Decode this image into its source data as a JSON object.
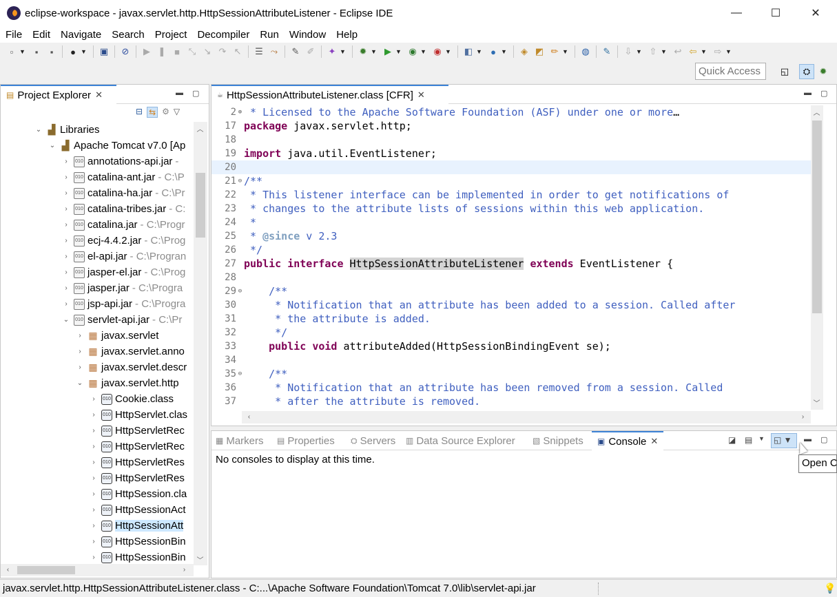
{
  "window": {
    "title": "eclipse-workspace - javax.servlet.http.HttpSessionAttributeListener - Eclipse IDE",
    "min_glyph": "—",
    "max_glyph": "☐",
    "close_glyph": "✕"
  },
  "menu": [
    "File",
    "Edit",
    "Navigate",
    "Search",
    "Project",
    "Decompiler",
    "Run",
    "Window",
    "Help"
  ],
  "quick_access": {
    "placeholder": "Quick Access"
  },
  "explorer": {
    "tab_label": "Project Explorer",
    "tab_close": "✕",
    "tree": [
      {
        "label": "Libraries",
        "path": "",
        "icon": "library-icon",
        "level": 0,
        "expanded": true
      },
      {
        "label": "Apache Tomcat v7.0 [Ap",
        "path": "",
        "icon": "library-icon",
        "level": 1,
        "expanded": true
      },
      {
        "label": "annotations-api.jar",
        "path": " - ",
        "icon": "jar-icon",
        "level": 2,
        "expanded": false
      },
      {
        "label": "catalina-ant.jar",
        "path": " - C:\\P",
        "icon": "jar-icon",
        "level": 2,
        "expanded": false
      },
      {
        "label": "catalina-ha.jar",
        "path": " - C:\\Pr",
        "icon": "jar-icon",
        "level": 2,
        "expanded": false
      },
      {
        "label": "catalina-tribes.jar",
        "path": " - C:",
        "icon": "jar-icon",
        "level": 2,
        "expanded": false
      },
      {
        "label": "catalina.jar",
        "path": " - C:\\Progr",
        "icon": "jar-icon",
        "level": 2,
        "expanded": false
      },
      {
        "label": "ecj-4.4.2.jar",
        "path": " - C:\\Prog",
        "icon": "jar-icon",
        "level": 2,
        "expanded": false
      },
      {
        "label": "el-api.jar",
        "path": " - C:\\Progran",
        "icon": "jar-icon",
        "level": 2,
        "expanded": false
      },
      {
        "label": "jasper-el.jar",
        "path": " - C:\\Prog",
        "icon": "jar-icon",
        "level": 2,
        "expanded": false
      },
      {
        "label": "jasper.jar",
        "path": " - C:\\Progra",
        "icon": "jar-icon",
        "level": 2,
        "expanded": false
      },
      {
        "label": "jsp-api.jar",
        "path": " - C:\\Progra",
        "icon": "jar-icon",
        "level": 2,
        "expanded": false
      },
      {
        "label": "servlet-api.jar",
        "path": " - C:\\Pr",
        "icon": "jar-icon",
        "level": 2,
        "expanded": true
      },
      {
        "label": "javax.servlet",
        "path": "",
        "icon": "package-icon",
        "level": 3,
        "expanded": false
      },
      {
        "label": "javax.servlet.anno",
        "path": "",
        "icon": "package-icon",
        "level": 3,
        "expanded": false
      },
      {
        "label": "javax.servlet.descr",
        "path": "",
        "icon": "package-icon",
        "level": 3,
        "expanded": false
      },
      {
        "label": "javax.servlet.http",
        "path": "",
        "icon": "package-icon",
        "level": 3,
        "expanded": true
      },
      {
        "label": "Cookie.class",
        "path": "",
        "icon": "class-file-icon",
        "level": 4,
        "expanded": false
      },
      {
        "label": "HttpServlet.clas",
        "path": "",
        "icon": "class-file-icon",
        "level": 4,
        "expanded": false
      },
      {
        "label": "HttpServletRec",
        "path": "",
        "icon": "class-file-icon",
        "level": 4,
        "expanded": false
      },
      {
        "label": "HttpServletRec",
        "path": "",
        "icon": "class-file-icon",
        "level": 4,
        "expanded": false
      },
      {
        "label": "HttpServletRes",
        "path": "",
        "icon": "class-file-icon",
        "level": 4,
        "expanded": false
      },
      {
        "label": "HttpServletRes",
        "path": "",
        "icon": "class-file-icon",
        "level": 4,
        "expanded": false
      },
      {
        "label": "HttpSession.cla",
        "path": "",
        "icon": "class-file-icon",
        "level": 4,
        "expanded": false
      },
      {
        "label": "HttpSessionAct",
        "path": "",
        "icon": "class-file-icon",
        "level": 4,
        "expanded": false
      },
      {
        "label": "HttpSessionAtt",
        "path": "",
        "icon": "class-file-icon",
        "level": 4,
        "expanded": false,
        "selected": true
      },
      {
        "label": "HttpSessionBin",
        "path": "",
        "icon": "class-file-icon",
        "level": 4,
        "expanded": false
      },
      {
        "label": "HttpSessionBin",
        "path": "",
        "icon": "class-file-icon",
        "level": 4,
        "expanded": false
      }
    ]
  },
  "editor": {
    "tab_label": "HttpSessionAttributeListener.class [CFR]",
    "tab_close": "✕",
    "lines": [
      {
        "n": "2",
        "fold": "⊕",
        "parts": [
          [
            " * Licensed to the Apache Software Foundation (ASF) under one or more",
            "cm"
          ],
          [
            "…",
            "pl"
          ]
        ]
      },
      {
        "n": "17",
        "fold": "",
        "parts": [
          [
            "package",
            "kw"
          ],
          [
            " javax.servlet.http;",
            "pl"
          ]
        ]
      },
      {
        "n": "18",
        "fold": "",
        "parts": []
      },
      {
        "n": "19",
        "fold": "",
        "parts": [
          [
            "import",
            "kw"
          ],
          [
            " java.util.EventListener;",
            "pl"
          ]
        ]
      },
      {
        "n": "20",
        "fold": "",
        "parts": [],
        "current": true
      },
      {
        "n": "21",
        "fold": "⊖",
        "parts": [
          [
            "/**",
            "cm"
          ]
        ]
      },
      {
        "n": "22",
        "fold": "",
        "parts": [
          [
            " * This listener interface can be implemented in order to get notifications of",
            "cm"
          ]
        ]
      },
      {
        "n": "23",
        "fold": "",
        "parts": [
          [
            " * changes to the attribute lists of sessions within this web application.",
            "cm"
          ]
        ]
      },
      {
        "n": "24",
        "fold": "",
        "parts": [
          [
            " *",
            "cm"
          ]
        ]
      },
      {
        "n": "25",
        "fold": "",
        "parts": [
          [
            " * ",
            "cm"
          ],
          [
            "@since",
            "tg"
          ],
          [
            " v 2.3",
            "cm"
          ]
        ]
      },
      {
        "n": "26",
        "fold": "",
        "parts": [
          [
            " */",
            "cm"
          ]
        ]
      },
      {
        "n": "27",
        "fold": "",
        "parts": [
          [
            "public",
            "kw"
          ],
          [
            " ",
            "pl"
          ],
          [
            "interface",
            "kw"
          ],
          [
            " ",
            "pl"
          ],
          [
            "HttpSessionAttributeListener",
            "hl"
          ],
          [
            " ",
            "pl"
          ],
          [
            "extends",
            "kw"
          ],
          [
            " EventListener {",
            "pl"
          ]
        ]
      },
      {
        "n": "28",
        "fold": "",
        "parts": []
      },
      {
        "n": "29",
        "fold": "⊖",
        "parts": [
          [
            "    /**",
            "cm"
          ]
        ]
      },
      {
        "n": "30",
        "fold": "",
        "parts": [
          [
            "     * Notification that an attribute has been added to a session. Called after",
            "cm"
          ]
        ]
      },
      {
        "n": "31",
        "fold": "",
        "parts": [
          [
            "     * the attribute is added.",
            "cm"
          ]
        ]
      },
      {
        "n": "32",
        "fold": "",
        "parts": [
          [
            "     */",
            "cm"
          ]
        ]
      },
      {
        "n": "33",
        "fold": "",
        "parts": [
          [
            "    ",
            "pl"
          ],
          [
            "public",
            "kw"
          ],
          [
            " ",
            "pl"
          ],
          [
            "void",
            "kw"
          ],
          [
            " attributeAdded(HttpSessionBindingEvent se);",
            "pl"
          ]
        ]
      },
      {
        "n": "34",
        "fold": "",
        "parts": []
      },
      {
        "n": "35",
        "fold": "⊖",
        "parts": [
          [
            "    /**",
            "cm"
          ]
        ]
      },
      {
        "n": "36",
        "fold": "",
        "parts": [
          [
            "     * Notification that an attribute has been removed from a session. Called",
            "cm"
          ]
        ]
      },
      {
        "n": "37",
        "fold": "",
        "parts": [
          [
            "     * after the attribute is removed.",
            "cm"
          ]
        ]
      }
    ]
  },
  "console": {
    "tabs": [
      {
        "label": "Markers",
        "icon": "markers-icon",
        "glyph": "▦"
      },
      {
        "label": "Properties",
        "icon": "properties-icon",
        "glyph": "▤"
      },
      {
        "label": "Servers",
        "icon": "servers-icon",
        "glyph": "⛭"
      },
      {
        "label": "Data Source Explorer",
        "icon": "data-source-icon",
        "glyph": "▥"
      },
      {
        "label": "Snippets",
        "icon": "snippets-icon",
        "glyph": "▧"
      }
    ],
    "active_tab": "Console",
    "active_close": "✕",
    "message": "No consoles to display at this time.",
    "tooltip": "Open C"
  },
  "status": {
    "text": "javax.servlet.http.HttpSessionAttributeListener.class - C:...\\Apache Software Foundation\\Tomcat 7.0\\lib\\servlet-api.jar"
  },
  "colors": {
    "keyword": "#7f0055",
    "comment": "#3f5fbf",
    "javadoc_tag": "#7f9fbf",
    "selection": "#cde8ff",
    "active_tab_accent": "#3c82d6"
  }
}
